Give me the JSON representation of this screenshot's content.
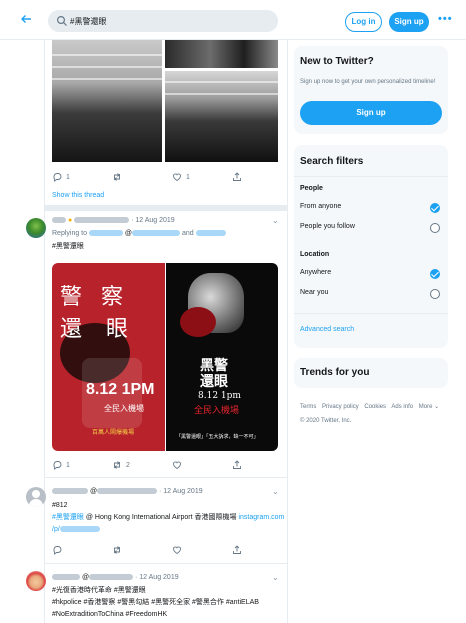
{
  "search": {
    "query": "#黑警還眼"
  },
  "header": {
    "login_label": "Log in",
    "signup_label": "Sign up",
    "more_label": "•••"
  },
  "tweet0": {
    "actions": {
      "reply_count": "1",
      "retweet_count": "",
      "like_count": "1"
    },
    "show_thread": "Show this thread"
  },
  "tweet1": {
    "date": "· 12 Aug 2019",
    "replying_to": "Replying to",
    "and_word": "and",
    "hashtag": "#黑警還眼",
    "media_left": {
      "line1": "警 察",
      "line2": "還",
      "line3": "眼",
      "time": "8.12 1PM",
      "place": "全民入機場",
      "footer": "百萬人鬧爆機場"
    },
    "media_right": {
      "title1": "黑警",
      "title2": "還眼",
      "time": "8.12 1pm",
      "place": "全民入機場",
      "footer": "「黑警還眼」「五大訴求，缺一不可」"
    },
    "actions": {
      "reply_count": "1",
      "retweet_count": "2",
      "like_count": ""
    }
  },
  "tweet2": {
    "date": "· 12 Aug 2019",
    "line1": "#812",
    "hashtag": "#黑警還眼",
    "text_mid": " @ Hong Kong International Airport 香港國際機場 ",
    "link": "instagram.com",
    "link2": "/p/"
  },
  "tweet3": {
    "date": "· 12 Aug 2019",
    "line1_tags": "#光復香港時代革命 #黑警還眼",
    "line2_tags": "#hkpolice #香港警察 #警黑勾結 #黑警死全家 #警黑合作 #antiELAB",
    "line3_tags": "#NoExtraditionToChina #FreedomHK"
  },
  "new_to_twitter": {
    "title": "New to Twitter?",
    "text": "Sign up now to get your own personalized timeline!",
    "signup_label": "Sign up"
  },
  "search_filters": {
    "title": "Search filters",
    "people_label": "People",
    "people_options": [
      {
        "label": "From anyone",
        "selected": true
      },
      {
        "label": "People you follow",
        "selected": false
      }
    ],
    "location_label": "Location",
    "location_options": [
      {
        "label": "Anywhere",
        "selected": true
      },
      {
        "label": "Near you",
        "selected": false
      }
    ],
    "advanced_label": "Advanced search"
  },
  "trends": {
    "title": "Trends for you"
  },
  "footer": {
    "links": [
      "Terms",
      "Privacy policy",
      "Cookies",
      "Ads info",
      "More ⌄"
    ],
    "copyright": "© 2020 Twitter, Inc."
  },
  "colors": {
    "accent": "#1da1f2",
    "muted": "#657786",
    "border": "#e6ecf0"
  }
}
